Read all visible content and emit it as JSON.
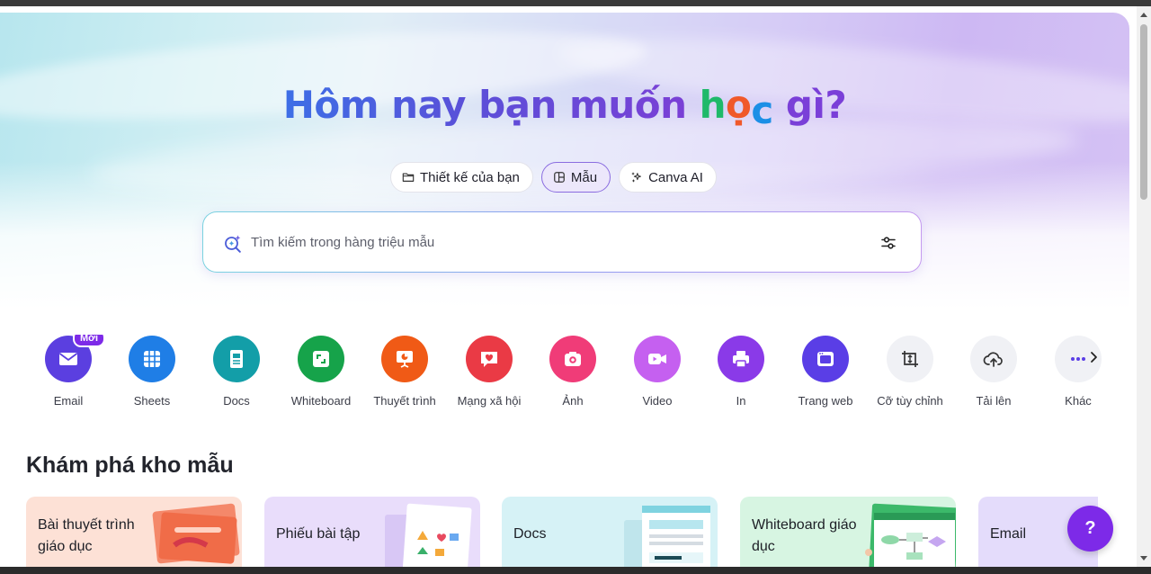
{
  "hero": {
    "headline_part1": "Hôm nay bạn muốn ",
    "headline_h": "h",
    "headline_o": "ọ",
    "headline_c": "c",
    "headline_part2": " gì?"
  },
  "mode_tabs": [
    {
      "label": "Thiết kế của bạn",
      "icon": "folder-icon",
      "active": false
    },
    {
      "label": "Mẫu",
      "icon": "template-icon",
      "active": true
    },
    {
      "label": "Canva AI",
      "icon": "sparkle-icon",
      "active": false
    }
  ],
  "search": {
    "placeholder": "Tìm kiếm trong hàng triệu mẫu",
    "icon": "ai-search-icon",
    "filter_icon": "filter-icon"
  },
  "shortcuts": [
    {
      "label": "Email",
      "icon": "mail-icon",
      "color": "#5b3fe0",
      "badge": "Mới"
    },
    {
      "label": "Sheets",
      "icon": "table-icon",
      "color": "#1f7ee6"
    },
    {
      "label": "Docs",
      "icon": "doc-icon",
      "color": "#139ea8"
    },
    {
      "label": "Whiteboard",
      "icon": "whiteboard-icon",
      "color": "#16a34a"
    },
    {
      "label": "Thuyết trình",
      "icon": "presentation-icon",
      "color": "#f05a16"
    },
    {
      "label": "Mạng xã hội",
      "icon": "heart-icon",
      "color": "#ea3a45"
    },
    {
      "label": "Ảnh",
      "icon": "camera-icon",
      "color": "#f03c78"
    },
    {
      "label": "Video",
      "icon": "video-icon",
      "color": "#c560f0"
    },
    {
      "label": "In",
      "icon": "printer-icon",
      "color": "#8a3ae8"
    },
    {
      "label": "Trang web",
      "icon": "website-icon",
      "color": "#5a3ee6"
    },
    {
      "label": "Cỡ tùy chỉnh",
      "icon": "resize-icon",
      "color": "#f0f1f5"
    },
    {
      "label": "Tải lên",
      "icon": "upload-cloud-icon",
      "color": "#f0f1f5"
    },
    {
      "label": "Khác",
      "icon": "more-icon",
      "color": "#f0f1f5"
    }
  ],
  "explore": {
    "title": "Khám phá kho mẫu",
    "cards": [
      {
        "title": "Bài thuyết trình giáo dục",
        "bg": "#fde1d6"
      },
      {
        "title": "Phiếu bài tập",
        "bg": "#e9ddfb"
      },
      {
        "title": "Docs",
        "bg": "#d6f2f6"
      },
      {
        "title": "Whiteboard giáo dục",
        "bg": "#d7f5e2"
      },
      {
        "title": "Email",
        "bg": "#e4dcfb"
      }
    ]
  },
  "help": {
    "label": "?"
  }
}
